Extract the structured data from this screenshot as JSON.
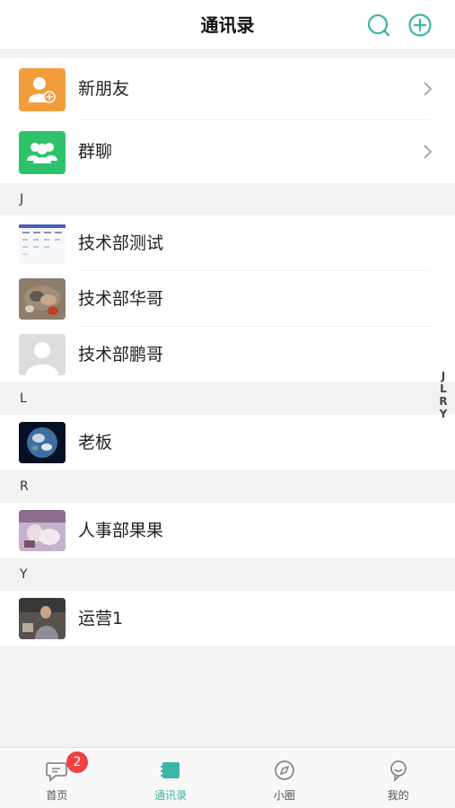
{
  "header": {
    "title": "通讯录",
    "search_icon": "search-icon",
    "add_icon": "add-circle-icon",
    "accent": "#3bb5a5"
  },
  "top_items": [
    {
      "label": "新朋友",
      "icon": "add-friend-icon",
      "color": "#f39c3c"
    },
    {
      "label": "群聊",
      "icon": "group-chat-icon",
      "color": "#2ec36a"
    }
  ],
  "sections": [
    {
      "letter": "J",
      "contacts": [
        {
          "name": "技术部测试"
        },
        {
          "name": "技术部华哥"
        },
        {
          "name": "技术部鹏哥"
        }
      ]
    },
    {
      "letter": "L",
      "contacts": [
        {
          "name": "老板"
        }
      ]
    },
    {
      "letter": "R",
      "contacts": [
        {
          "name": "人事部果果"
        }
      ]
    },
    {
      "letter": "Y",
      "contacts": [
        {
          "name": "运营1"
        }
      ]
    }
  ],
  "index_letters": [
    "J",
    "L",
    "R",
    "Y"
  ],
  "tabs": [
    {
      "label": "首页",
      "icon": "chat-bubble-icon",
      "badge": "2"
    },
    {
      "label": "通讯录",
      "icon": "contacts-book-icon",
      "active": true
    },
    {
      "label": "小圈",
      "icon": "compass-icon"
    },
    {
      "label": "我的",
      "icon": "profile-icon"
    }
  ]
}
